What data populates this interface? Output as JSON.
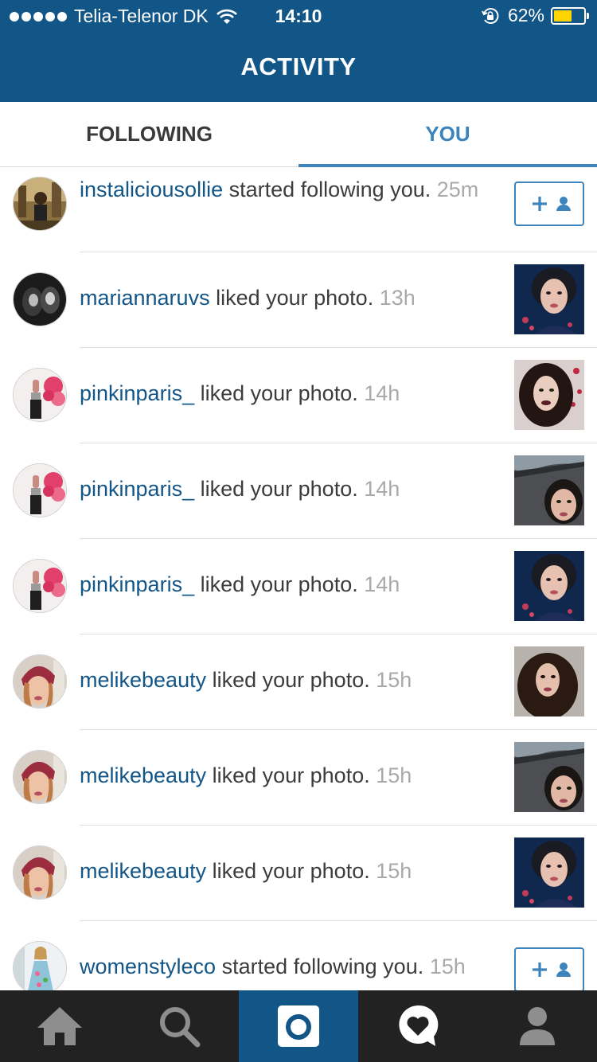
{
  "status_bar": {
    "carrier": "Telia-Telenor DK",
    "time": "14:10",
    "battery_percent": "62%",
    "battery_level": 0.62,
    "signal_icon": "signal-dots-icon",
    "wifi_icon": "wifi-icon",
    "lock_icon": "rotation-lock-icon"
  },
  "header": {
    "title": "ACTIVITY"
  },
  "tabs": {
    "following": "FOLLOWING",
    "you": "YOU",
    "active": "you"
  },
  "activity": {
    "items": [
      {
        "username": "instaliciousollie",
        "action": " started following you. ",
        "time": "25m",
        "kind": "follow"
      },
      {
        "username": "mariannaruvs",
        "action": " liked your photo. ",
        "time": "13h",
        "kind": "like"
      },
      {
        "username": "pinkinparis_",
        "action": " liked your photo. ",
        "time": "14h",
        "kind": "like"
      },
      {
        "username": "pinkinparis_",
        "action": " liked your photo. ",
        "time": "14h",
        "kind": "like"
      },
      {
        "username": "pinkinparis_",
        "action": " liked your photo. ",
        "time": "14h",
        "kind": "like"
      },
      {
        "username": "melikebeauty",
        "action": " liked your photo. ",
        "time": "15h",
        "kind": "like"
      },
      {
        "username": "melikebeauty",
        "action": " liked your photo. ",
        "time": "15h",
        "kind": "like"
      },
      {
        "username": "melikebeauty",
        "action": " liked your photo. ",
        "time": "15h",
        "kind": "like"
      },
      {
        "username": "womenstyleco",
        "action": " started following you. ",
        "time": "15h",
        "kind": "follow"
      }
    ]
  },
  "tab_bar": {
    "items": [
      "home-icon",
      "search-icon",
      "camera-icon",
      "activity-heart-icon",
      "profile-icon"
    ],
    "active": "camera-icon"
  },
  "colors": {
    "brand": "#125688",
    "accent": "#3d84bd",
    "username": "#125688",
    "timestamp": "#a9a9a9",
    "tab_bar": "#222222",
    "battery": "#ffd400"
  }
}
